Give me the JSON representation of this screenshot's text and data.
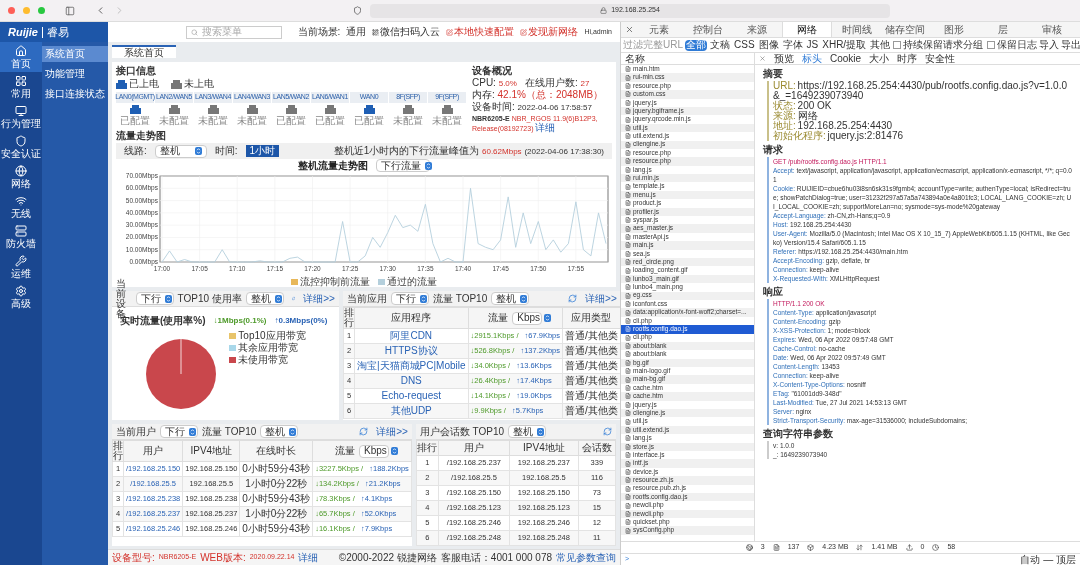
{
  "browser": {
    "url": "192.168.25.254"
  },
  "app": {
    "logo": {
      "brand": "Ruijie",
      "name": "睿易"
    },
    "nav": [
      {
        "label": "首页",
        "selected": true
      },
      {
        "label": "常用",
        "selected": false
      },
      {
        "label": "行为管理",
        "selected": false
      },
      {
        "label": "安全认证",
        "selected": false
      },
      {
        "label": "网络",
        "selected": false
      },
      {
        "label": "无线",
        "selected": false
      },
      {
        "label": "防火墙",
        "selected": false
      },
      {
        "label": "运维",
        "selected": false
      },
      {
        "label": "高级",
        "selected": false
      }
    ],
    "submenu": [
      {
        "label": "系统首页",
        "selected": true
      },
      {
        "label": "功能管理",
        "selected": false
      },
      {
        "label": "接口连接状态",
        "selected": false
      }
    ],
    "header": {
      "search_placeholder": "搜索菜单",
      "scene_label": "当前场景:",
      "scene": "通用",
      "wechat": "微信扫码入云",
      "quick": "本地快速配置",
      "discover": "发现新网络",
      "user": "Hi,admin"
    },
    "tab": "系统首页",
    "interface": {
      "title": "接口信息",
      "legend": [
        {
          "label": "已上电",
          "powered": true
        },
        {
          "label": "未上电",
          "powered": false
        }
      ],
      "ports": [
        {
          "name": "LAN0(MGMT)",
          "powered": true,
          "status": "已配置"
        },
        {
          "name": "LAN2/WAN5",
          "powered": false,
          "status": "未配置"
        },
        {
          "name": "LAN3/WAN4",
          "powered": false,
          "status": "未配置"
        },
        {
          "name": "LAN4/WAN3",
          "powered": false,
          "status": "未配置"
        },
        {
          "name": "LAN5/WAN2",
          "powered": false,
          "status": "已配置"
        },
        {
          "name": "LAN6/WAN1",
          "powered": false,
          "status": "已配置"
        },
        {
          "name": "WAN0",
          "powered": true,
          "status": "已配置"
        },
        {
          "name": "8F(SFP)",
          "powered": false,
          "status": "未配置"
        },
        {
          "name": "9F(SFP)",
          "powered": false,
          "status": "未配置"
        }
      ]
    },
    "overview": {
      "title": "设备概况",
      "cpu_label": "CPU:",
      "cpu": "5.0%",
      "users_label": "在线用户数:",
      "users": "27",
      "mem_label": "内存:",
      "mem": "42.1%（总：2048MB）",
      "time_label": "设备时间:",
      "time": "2022-04-06 17:58:57",
      "model": "NBR6205-E",
      "version": "NBR_RGOS 11.9(6)B12P3, Release(08192723)",
      "detail": "详细"
    },
    "flow": {
      "title": "流量走势图",
      "line_label": "线路:",
      "line": "整机",
      "time_label": "时间:",
      "time": "1小时",
      "peak_label": "整机近1小时内的下行流量峰值为",
      "peak": "60.62Mbps",
      "peak_time": "(2022-04-06 17:38:30)",
      "direction": "下行流量",
      "chart_data": {
        "type": "line",
        "title": "整机流量走势图",
        "categories": [
          "17:00",
          null,
          null,
          null,
          null,
          "17:05",
          null,
          null,
          null,
          null,
          "17:10",
          null,
          null,
          null,
          null,
          "17:15",
          null,
          null,
          null,
          null,
          "17:20",
          null,
          null,
          null,
          null,
          "17:25",
          null,
          null,
          null,
          null,
          "17:30",
          null,
          null,
          null,
          null,
          "17:35",
          null,
          null,
          null,
          null,
          "17:40",
          null,
          null,
          null,
          null,
          "17:45",
          null,
          null,
          null,
          null,
          "17:50",
          null,
          null,
          null,
          null,
          "17:55",
          null,
          null,
          null,
          null
        ],
        "series": [
          {
            "name": "流控抑制前流量",
            "color": "#e8b85a",
            "values": [
              null,
              null,
              null,
              null,
              null,
              null,
              null,
              null,
              null,
              null,
              null,
              null,
              null,
              null,
              null,
              null,
              null,
              null,
              null,
              null,
              null,
              null,
              null,
              null,
              null,
              null,
              null,
              null,
              null,
              null,
              null,
              null,
              null,
              null,
              null,
              null,
              null,
              null,
              null,
              null,
              null,
              null,
              null,
              null,
              null,
              null,
              null,
              null,
              null,
              null,
              null,
              null,
              null,
              null,
              null,
              null,
              null,
              null,
              null,
              null
            ]
          },
          {
            "name": "通过的流量",
            "color": "#b4cfdc",
            "values": [
              0,
              9,
              0,
              2,
              0,
              0,
              0,
              0,
              10,
              0,
              0,
              0,
              0,
              1,
              0,
              0,
              0,
              3,
              4,
              0,
              0,
              0,
              0,
              0,
              33,
              0,
              0,
              5,
              20,
              12,
              24,
              38,
              28,
              30,
              25,
              47,
              15,
              0,
              3,
              0,
              0,
              60,
              15,
              12,
              10,
              18,
              53,
              12,
              40,
              15,
              33,
              10,
              18,
              8,
              15,
              49,
              10,
              5,
              40,
              15
            ]
          }
        ],
        "ylim": [
          0,
          70
        ],
        "grid": true,
        "legend": "bottom",
        "yticks": [
          {
            "value": 0,
            "label": "0.00Mbps"
          },
          {
            "value": 10,
            "label": "10.00Mbps"
          },
          {
            "value": 20,
            "label": "20.00Mbps"
          },
          {
            "value": 30,
            "label": "30.00Mbps"
          },
          {
            "value": 40,
            "label": "40.00Mbps"
          },
          {
            "value": 50,
            "label": "50.00Mbps"
          },
          {
            "value": 60,
            "label": "60.00Mbps"
          },
          {
            "value": 70,
            "label": "70.00Mbps"
          }
        ]
      }
    },
    "device_panel": {
      "title": "当前设备",
      "direction": "下行",
      "metric": "TOP10 使用率",
      "scope": "整机",
      "more": "详细>>",
      "realtime": "实时流量(使用率%)",
      "down": "↓1Mbps(0.1%)",
      "up": "↑0.3Mbps(0%)",
      "legend": [
        {
          "label": "Top10应用带宽",
          "color": "#e8c46a"
        },
        {
          "label": "其余应用带宽",
          "color": "#a9d8ea"
        },
        {
          "label": "未使用带宽",
          "color": "#c9474c"
        }
      ]
    },
    "app_panel": {
      "title": "当前应用",
      "direction": "下行",
      "metric": "流量 TOP10",
      "scope": "整机",
      "more": "详细>>",
      "columns": [
        "排行",
        "应用程序",
        "流量",
        "应用类型"
      ],
      "unit": "Kbps",
      "rows": [
        {
          "rank": "1",
          "app": "阿里CDN",
          "down": "↓2915.1Kbps /",
          "up": "↑67.9Kbps",
          "type": "普通/其他类"
        },
        {
          "rank": "2",
          "app": "HTTPS协议",
          "down": "↓526.8Kbps /",
          "up": "↑137.2Kbps",
          "type": "普通/其他类"
        },
        {
          "rank": "3",
          "app": "淘宝|天猫商城PC|Mobile",
          "down": "↓34.0Kbps /",
          "up": "↑13.6Kbps",
          "type": "普通/其他类"
        },
        {
          "rank": "4",
          "app": "DNS",
          "down": "↓26.4Kbps /",
          "up": "↑17.4Kbps",
          "type": "普通/其他类"
        },
        {
          "rank": "5",
          "app": "Echo-request",
          "down": "↓14.1Kbps /",
          "up": "↑19.0Kbps",
          "type": "普通/其他类"
        },
        {
          "rank": "6",
          "app": "其他UDP",
          "down": "↓9.9Kbps /",
          "up": "↑5.7Kbps",
          "type": "普通/其他类"
        }
      ]
    },
    "user_panel": {
      "title": "当前用户",
      "direction": "下行",
      "metric": "流量 TOP10",
      "scope": "整机",
      "more": "详细>>",
      "columns": [
        "排行",
        "用户",
        "IPV4地址",
        "在线时长",
        "流量"
      ],
      "unit": "Kbps",
      "rows": [
        {
          "rank": "1",
          "user": "/192.168.25.150",
          "ip": "192.168.25.150",
          "duration": "0小时59分43秒",
          "down": "↓3227.5Kbps /",
          "up": "↑188.2Kbps"
        },
        {
          "rank": "2",
          "user": "/192.168.25.5",
          "ip": "192.168.25.5",
          "duration": "1小时0分22秒",
          "down": "↓134.2Kbps /",
          "up": "↑21.2Kbps"
        },
        {
          "rank": "3",
          "user": "/192.168.25.238",
          "ip": "192.168.25.238",
          "duration": "0小时59分43秒",
          "down": "↓78.3Kbps /",
          "up": "↑4.1Kbps"
        },
        {
          "rank": "4",
          "user": "/192.168.25.237",
          "ip": "192.168.25.237",
          "duration": "1小时0分22秒",
          "down": "↓65.7Kbps /",
          "up": "↑52.0Kbps"
        },
        {
          "rank": "5",
          "user": "/192.168.25.246",
          "ip": "192.168.25.246",
          "duration": "0小时59分43秒",
          "down": "↓16.1Kbps /",
          "up": "↑7.9Kbps"
        }
      ]
    },
    "session_panel": {
      "title": "用户会话数 TOP10",
      "scope": "整机",
      "columns": [
        "排行",
        "用户",
        "IPV4地址",
        "会话数"
      ],
      "rows": [
        {
          "rank": "1",
          "user": "/192.168.25.237",
          "ip": "192.168.25.237",
          "count": "339"
        },
        {
          "rank": "2",
          "user": "/192.168.25.5",
          "ip": "192.168.25.5",
          "count": "116"
        },
        {
          "rank": "3",
          "user": "/192.168.25.150",
          "ip": "192.168.25.150",
          "count": "73"
        },
        {
          "rank": "4",
          "user": "/192.168.25.123",
          "ip": "192.168.25.123",
          "count": "15"
        },
        {
          "rank": "5",
          "user": "/192.168.25.246",
          "ip": "192.168.25.246",
          "count": "12"
        },
        {
          "rank": "6",
          "user": "/192.168.25.248",
          "ip": "192.168.25.248",
          "count": "11"
        }
      ]
    },
    "footer": {
      "model_label": "设备型号:",
      "model": "NBR6205-E",
      "web_label": "WEB版本:",
      "web": "2020.09.22.14",
      "detail": "详细",
      "copyright": "©2000-2022 锐捷网络",
      "phone": "客服电话：4001 000 078",
      "faq": "常见参数查询"
    }
  },
  "devtools": {
    "tabs": [
      {
        "label": "元素",
        "selected": false
      },
      {
        "label": "控制台",
        "selected": false
      },
      {
        "label": "来源",
        "selected": false
      },
      {
        "label": "网络",
        "selected": true
      },
      {
        "label": "时间线",
        "selected": false
      },
      {
        "label": "储存空间",
        "selected": false
      },
      {
        "label": "图形",
        "selected": false
      },
      {
        "label": "层",
        "selected": false
      },
      {
        "label": "审核",
        "selected": false
      }
    ],
    "filter_placeholder": "过滤完整URL",
    "types": [
      {
        "label": "全部",
        "selected": true
      },
      {
        "label": "文稿",
        "selected": false
      },
      {
        "label": "CSS",
        "selected": false
      },
      {
        "label": "图像",
        "selected": false
      },
      {
        "label": "字体",
        "selected": false
      },
      {
        "label": "JS",
        "selected": false
      },
      {
        "label": "XHR/提取",
        "selected": false
      },
      {
        "label": "其他",
        "selected": false
      }
    ],
    "group_option": {
      "label": "持续保留请求分组",
      "checked": false
    },
    "preserve_log": {
      "label": "保留日志",
      "checked": false
    },
    "import": "导入",
    "export": "导出",
    "list_header": "名称",
    "files": [
      {
        "name": "main.htm",
        "selected": false
      },
      {
        "name": "rui-min.css",
        "selected": false
      },
      {
        "name": "resource.php",
        "selected": false
      },
      {
        "name": "custom.css",
        "selected": false
      },
      {
        "name": "jquery.js",
        "selected": false
      },
      {
        "name": "jquery.bgiframe.js",
        "selected": false
      },
      {
        "name": "jquery.qrcode.min.js",
        "selected": false
      },
      {
        "name": "util.js",
        "selected": false
      },
      {
        "name": "util.extend.js",
        "selected": false
      },
      {
        "name": "cliengine.js",
        "selected": false
      },
      {
        "name": "resource.php",
        "selected": false
      },
      {
        "name": "resource.php",
        "selected": false
      },
      {
        "name": "lang.js",
        "selected": false
      },
      {
        "name": "rui.min.js",
        "selected": false
      },
      {
        "name": "template.js",
        "selected": false
      },
      {
        "name": "menu.js",
        "selected": false
      },
      {
        "name": "product.js",
        "selected": false
      },
      {
        "name": "profiler.js",
        "selected": false
      },
      {
        "name": "syspar.js",
        "selected": false
      },
      {
        "name": "aes_master.js",
        "selected": false
      },
      {
        "name": "masterApi.js",
        "selected": false
      },
      {
        "name": "main.js",
        "selected": false
      },
      {
        "name": "sea.js",
        "selected": false
      },
      {
        "name": "red_circle.png",
        "selected": false
      },
      {
        "name": "loading_content.gif",
        "selected": false
      },
      {
        "name": "lunbo3_main.gif",
        "selected": false
      },
      {
        "name": "lunbo4_main.png",
        "selected": false
      },
      {
        "name": "eg.css",
        "selected": false
      },
      {
        "name": "iconfont.css",
        "selected": false
      },
      {
        "name": "data:application/x-font-woff2;charset=...",
        "selected": false
      },
      {
        "name": "cli.php",
        "selected": false
      },
      {
        "name": "rootfs.config.dao.js",
        "selected": true
      },
      {
        "name": "cli.php",
        "selected": false
      },
      {
        "name": "about:blank",
        "selected": false
      },
      {
        "name": "about:blank",
        "selected": false
      },
      {
        "name": "bg.gif",
        "selected": false
      },
      {
        "name": "main-logo.gif",
        "selected": false
      },
      {
        "name": "main-bg.gif",
        "selected": false
      },
      {
        "name": "cache.htm",
        "selected": false
      },
      {
        "name": "cache.htm",
        "selected": false
      },
      {
        "name": "jquery.js",
        "selected": false
      },
      {
        "name": "cliengine.js",
        "selected": false
      },
      {
        "name": "util.js",
        "selected": false
      },
      {
        "name": "util.extend.js",
        "selected": false
      },
      {
        "name": "lang.js",
        "selected": false
      },
      {
        "name": "store.js",
        "selected": false
      },
      {
        "name": "interface.js",
        "selected": false
      },
      {
        "name": "intf.js",
        "selected": false
      },
      {
        "name": "device.js",
        "selected": false
      },
      {
        "name": "resource.zh.js",
        "selected": false
      },
      {
        "name": "resource.pub.zh.js",
        "selected": false
      },
      {
        "name": "rootfs.config.dao.js",
        "selected": false
      },
      {
        "name": "newcli.php",
        "selected": false
      },
      {
        "name": "newcli.php",
        "selected": false
      },
      {
        "name": "quickset.php",
        "selected": false
      },
      {
        "name": "sysConfig.php",
        "selected": false
      }
    ],
    "detail_tabs": [
      {
        "label": "预览",
        "selected": false
      },
      {
        "label": "标头",
        "selected": true
      },
      {
        "label": "Cookie",
        "selected": false
      },
      {
        "label": "大小",
        "selected": false
      },
      {
        "label": "时序",
        "selected": false
      },
      {
        "label": "安全性",
        "selected": false
      }
    ],
    "sections": [
      {
        "title": "摘要",
        "kind": "summary",
        "lines": [
          {
            "key": "URL:",
            "value": "https://192.168.25.254:4430/pub/rootfs.config.dao.js?v=1.0.0&_=1649239073940"
          },
          {
            "key": "状态:",
            "value": "200 OK"
          },
          {
            "key": "来源:",
            "value": "网络"
          },
          {
            "key": "地址:",
            "value": "192.168.25.254:4430"
          },
          {
            "key": "初始化程序:",
            "value": "jquery.js:2:81476"
          }
        ]
      },
      {
        "title": "请求",
        "kind": "headers",
        "first": "GET /pub/rootfs.config.dao.js HTTP/1.1",
        "lines": [
          {
            "key": "Accept:",
            "value": "text/javascript, application/javascript, application/ecmascript, application/x-ecmascript, */*; q=0.01"
          },
          {
            "key": "Cookie:",
            "value": "RUIJIEID=cbue6hu03i8sn6sk31s9fgmb4; accountType=write; authenType=local; isRedirect=true; showPatchDialog=true; user=31232f297a57a5a743894a0e4a801fc3; LOCAL_LANG_COOKIE=zh; UI_LOCAL_COOKIE=zh; supportMoreLan=no; sysmode=sys-mode%20gateway"
          },
          {
            "key": "Accept-Language:",
            "value": "zh-CN,zh-Hans;q=0.9"
          },
          {
            "key": "Host:",
            "value": "192.168.25.254:4430"
          },
          {
            "key": "User-Agent:",
            "value": "Mozilla/5.0 (Macintosh; Intel Mac OS X 10_15_7) AppleWebKit/605.1.15 (KHTML, like Gecko) Version/15.4 Safari/605.1.15"
          },
          {
            "key": "Referer:",
            "value": "https://192.168.25.254:4430/main.htm"
          },
          {
            "key": "Accept-Encoding:",
            "value": "gzip, deflate, br"
          },
          {
            "key": "Connection:",
            "value": "keep-alive"
          },
          {
            "key": "X-Requested-With:",
            "value": "XMLHttpRequest"
          }
        ]
      },
      {
        "title": "响应",
        "kind": "headers",
        "first": "HTTP/1.1 200 OK",
        "lines": [
          {
            "key": "Content-Type:",
            "value": "application/javascript"
          },
          {
            "key": "Content-Encoding:",
            "value": "gzip"
          },
          {
            "key": "X-XSS-Protection:",
            "value": "1; mode=block"
          },
          {
            "key": "Expires:",
            "value": "Wed, 06 Apr 2022 09:57:48 GMT"
          },
          {
            "key": "Cache-Control:",
            "value": "no-cache"
          },
          {
            "key": "Date:",
            "value": "Wed, 06 Apr 2022 09:57:49 GMT"
          },
          {
            "key": "Content-Length:",
            "value": "13453"
          },
          {
            "key": "Connection:",
            "value": "keep-alive"
          },
          {
            "key": "X-Content-Type-Options:",
            "value": "nosniff"
          },
          {
            "key": "ETag:",
            "value": "\"61001dd9-348d\""
          },
          {
            "key": "Last-Modified:",
            "value": "Tue, 27 Jul 2021 14:53:13 GMT"
          },
          {
            "key": "Server:",
            "value": "nginx"
          },
          {
            "key": "Strict-Transport-Security:",
            "value": "max-age=31536000; includeSubdomains;"
          }
        ]
      },
      {
        "title": "查询字符串参数",
        "kind": "params",
        "lines": [
          {
            "key": "v:",
            "value": "1.0.0"
          },
          {
            "key": "_:",
            "value": "1649239073940"
          }
        ]
      }
    ],
    "status": {
      "domains": "3",
      "requests": "137",
      "transferred": "4.23 MB",
      "resources": "1.41 MB",
      "errors": "0",
      "time": "58"
    },
    "prompt": ">",
    "context": "自动 — 顶层"
  }
}
